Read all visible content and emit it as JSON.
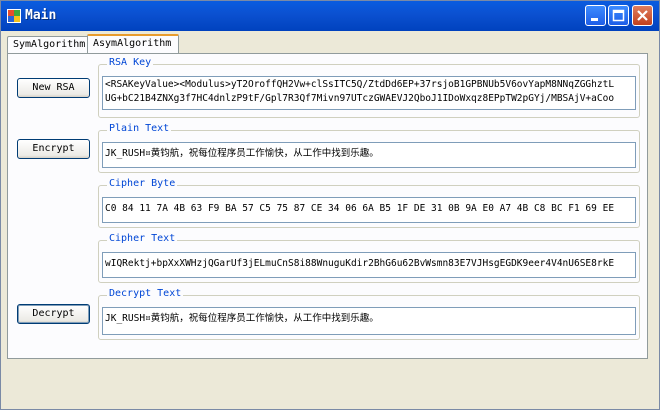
{
  "window": {
    "title": "Main",
    "accent_color": "#0054e3"
  },
  "tabs": [
    {
      "label": "SymAlgorithm",
      "active": false
    },
    {
      "label": "AsymAlgorithm",
      "active": true
    }
  ],
  "buttons": {
    "new_rsa": "New RSA",
    "encrypt": "Encrypt",
    "decrypt": "Decrypt"
  },
  "groups": {
    "rsa_key": {
      "label": "RSA Key",
      "lines": [
        "<RSAKeyValue><Modulus>yT2OroffQH2Vw+clSsITC5Q/ZtdDd6EP+37rsjoB1GPBNUb5V6ovYapM8NNqZGGhztL",
        "UG+bC21B4ZNXg3f7HC4dnlzP9tF/Gpl7R3Qf7Mivn97UTczGWAEVJ2QboJ1IDoWxqz8EPpTW2pGYj/MBSAjV+aCoo"
      ]
    },
    "plain_text": {
      "label": "Plain Text",
      "value": "JK_RUSH¤黄钧航，祝每位程序员工作愉快，从工作中找到乐趣。"
    },
    "cipher_byte": {
      "label": "Cipher Byte",
      "value": "C0 84 11 7A 4B 63 F9 BA 57 C5 75 87 CE 34 06 6A B5 1F DE 31 0B 9A E0 A7 4B C8 BC F1 69 EE"
    },
    "cipher_text": {
      "label": "Cipher Text",
      "value": "wIQRektj+bpXxXWHzjQGarUf3jELmuCnS8i88WnuguKdir2BhG6u62BvWsmn83E7VJHsgEGDK9eer4V4nU6SE8rkE"
    },
    "decrypt_text": {
      "label": "Decrypt Text",
      "value": "JK_RUSH¤黄钧航，祝每位程序员工作愉快，从工作中找到乐趣。"
    }
  }
}
